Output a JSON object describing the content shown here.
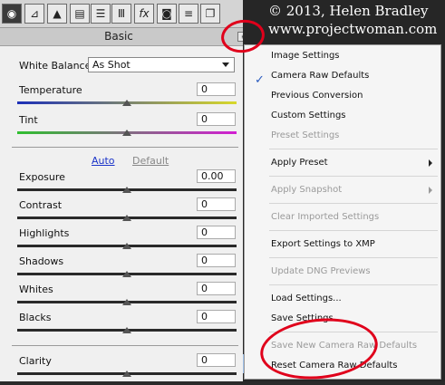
{
  "watermark": {
    "line1": "© 2013, Helen Bradley",
    "line2": "www.projectwoman.com"
  },
  "tabs": [
    "camera-icon",
    "tone-curve-icon",
    "triangle-icon",
    "split-box-icon",
    "bars-icon",
    "lens-icon",
    "fx",
    "photo-icon",
    "sliders-icon",
    "stack-icon"
  ],
  "tab_fx_label": "fx",
  "section": {
    "title": "Basic",
    "menu_glyph": "≡."
  },
  "white_balance": {
    "label": "White Balance:",
    "value": "As Shot"
  },
  "temperature": {
    "label": "Temperature",
    "value": "0"
  },
  "tint": {
    "label": "Tint",
    "value": "0"
  },
  "auto_label": "Auto",
  "default_label": "Default",
  "sliders": [
    {
      "label": "Exposure",
      "value": "0.00"
    },
    {
      "label": "Contrast",
      "value": "0"
    },
    {
      "label": "Highlights",
      "value": "0"
    },
    {
      "label": "Shadows",
      "value": "0"
    },
    {
      "label": "Whites",
      "value": "0"
    },
    {
      "label": "Blacks",
      "value": "0"
    }
  ],
  "clarity": {
    "label": "Clarity",
    "value": "0"
  },
  "menu": {
    "items": [
      {
        "label": "Image Settings",
        "enabled": true
      },
      {
        "label": "Camera Raw Defaults",
        "enabled": true,
        "checked": true
      },
      {
        "label": "Previous Conversion",
        "enabled": true
      },
      {
        "label": "Custom Settings",
        "enabled": true
      },
      {
        "label": "Preset Settings",
        "enabled": false
      },
      {
        "label": "Apply Preset",
        "enabled": true,
        "submenu": true
      },
      {
        "label": "Apply Snapshot",
        "enabled": false,
        "submenu": true
      },
      {
        "label": "Clear Imported Settings",
        "enabled": false
      },
      {
        "label": "Export Settings to XMP",
        "enabled": true
      },
      {
        "label": "Update DNG Previews",
        "enabled": false
      },
      {
        "label": "Load Settings...",
        "enabled": true
      },
      {
        "label": "Save Settings...",
        "enabled": true
      },
      {
        "label": "Save New Camera Raw Defaults",
        "enabled": false
      },
      {
        "label": "Reset Camera Raw Defaults",
        "enabled": true,
        "highlighted": true
      }
    ],
    "check_glyph": "✓"
  },
  "colors": {
    "panel_bg": "#f0f0f0",
    "accent_link": "#1a33c8",
    "annotation_red": "#e0001b",
    "menu_highlight": "#dde8f6"
  }
}
